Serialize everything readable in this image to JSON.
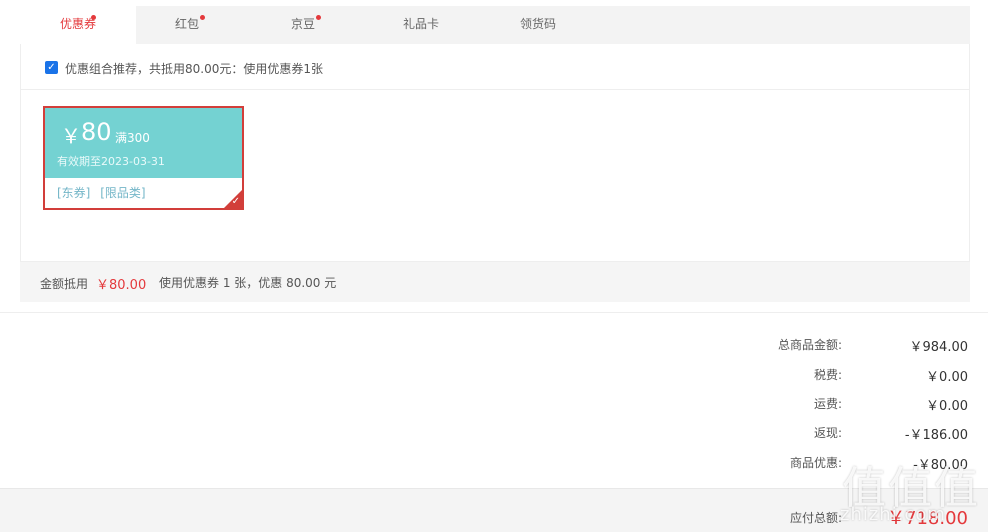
{
  "tabs": [
    {
      "label": "优惠券",
      "dot": true,
      "active": true
    },
    {
      "label": "红包",
      "dot": true,
      "active": false
    },
    {
      "label": "京豆",
      "dot": true,
      "active": false
    },
    {
      "label": "礼品卡",
      "dot": false,
      "active": false
    },
    {
      "label": "领货码",
      "dot": false,
      "active": false
    }
  ],
  "combo": {
    "checked": true,
    "text": "优惠组合推荐，共抵用80.00元：使用优惠券1张"
  },
  "coupon": {
    "currency": "￥",
    "amount": "80",
    "limit": "满300",
    "validity": "有效期至2023-03-31",
    "tags": [
      "[东券]",
      "[限品类]"
    ],
    "selected": true
  },
  "summary": {
    "label": "金额抵用",
    "value": "￥80.00",
    "desc": "使用优惠券 1 张，优惠 80.00 元"
  },
  "totals": [
    {
      "label": "总商品金额:",
      "value": "￥984.00"
    },
    {
      "label": "税费:",
      "value": "￥0.00"
    },
    {
      "label": "运费:",
      "value": "￥0.00"
    },
    {
      "label": "返现:",
      "value": "-￥186.00"
    },
    {
      "label": "商品优惠:",
      "value": "-￥80.00"
    }
  ],
  "payable": {
    "label": "应付总额:",
    "value": "￥718.00"
  },
  "watermark": {
    "glyphs": "值值值",
    "text": "zhizhi.com"
  },
  "colors": {
    "accent": "#e4393c",
    "coupon_bg": "#74d2d2",
    "checkbox": "#1a73e8"
  }
}
